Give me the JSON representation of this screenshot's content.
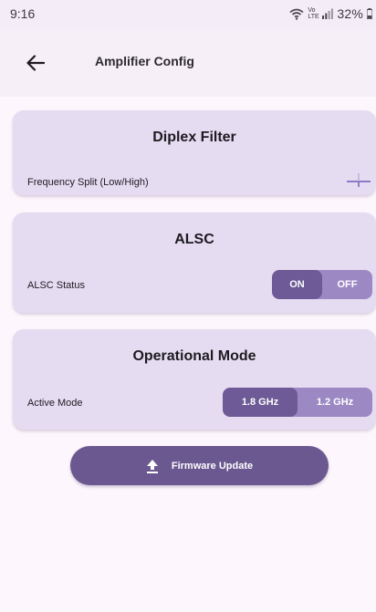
{
  "status_bar": {
    "time": "9:16",
    "network_label": "Vo LTE",
    "battery_level": "32%",
    "icons": [
      "wifi-icon",
      "signal-icon",
      "battery-icon"
    ]
  },
  "app_bar": {
    "title": "Amplifier Config",
    "back_icon": "arrow-left-icon"
  },
  "cards": {
    "diplex": {
      "title": "Diplex Filter",
      "row_label": "Frequency Split (Low/High)",
      "control_icon": "slider-icon"
    },
    "alsc": {
      "title": "ALSC",
      "row_label": "ALSC Status",
      "options": [
        "ON",
        "OFF"
      ],
      "selected": "ON"
    },
    "operational_mode": {
      "title": "Operational Mode",
      "row_label": "Active Mode",
      "options": [
        "1.8 GHz",
        "1.2 GHz"
      ],
      "selected": "1.8 GHz"
    }
  },
  "firmware_button": {
    "label": "Firmware Update",
    "icon": "upload-icon"
  },
  "colors": {
    "background": "#fdf7fd",
    "card": "#e6dcf2",
    "accent": "#6b5890",
    "segment_selected": "#6d5a96",
    "segment_unselected": "#9c89c4"
  }
}
